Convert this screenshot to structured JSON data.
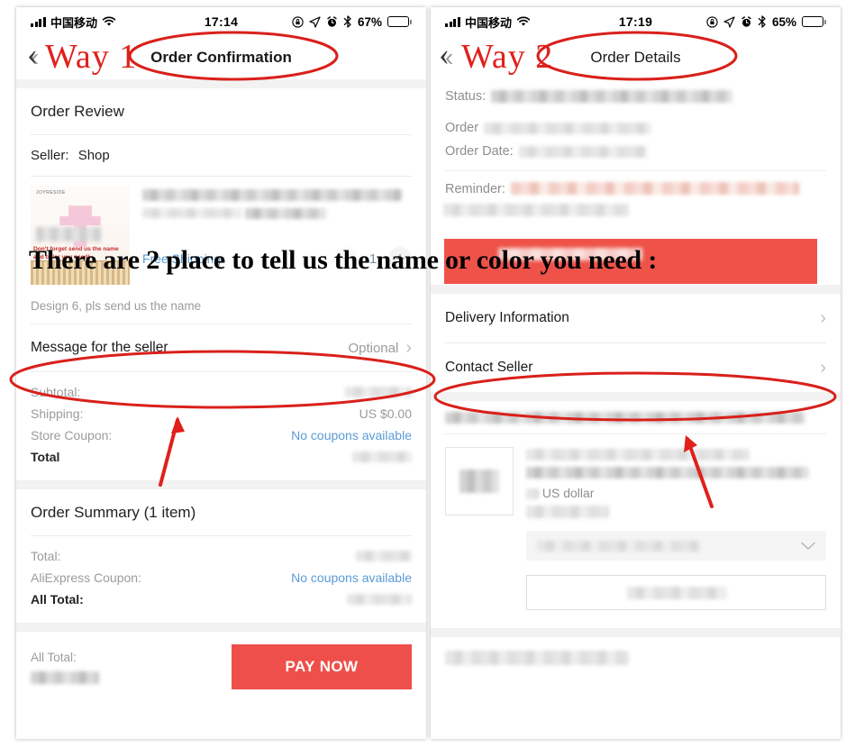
{
  "annotations": {
    "way1_label": "Way 1",
    "way2_label": "Way 2",
    "back_caret": "‹",
    "overlay_text": "There are 2 place to tell us the name or color you need :"
  },
  "left_phone": {
    "status_bar": {
      "carrier": "中国移动",
      "time": "17:14",
      "battery_percent": "67%",
      "icons": [
        "signal-bars-icon",
        "wifi-icon",
        "rotation-lock-icon",
        "location-arrow-icon",
        "alarm-clock-icon",
        "bluetooth-icon",
        "battery-icon"
      ]
    },
    "nav": {
      "back_icon": "‹",
      "title": "Order Confirmation"
    },
    "order_review": {
      "section_title": "Order Review",
      "seller_label": "Seller:",
      "seller_name": "Shop",
      "product": {
        "image_brand": "JOYRESIDE",
        "image_caption": "Don't forget send us the name and color you need!",
        "title_redacted": true,
        "free_shipping": "Free Shipping",
        "quantity": "1",
        "minus_icon": "−",
        "plus_icon": "+"
      },
      "design_note": "Design 6, pls send us the name",
      "message_for_seller": {
        "label": "Message for the seller",
        "value": "Optional",
        "chevron": "›"
      },
      "totals": [
        {
          "label": "Subtotal:",
          "value": "",
          "value_redacted": true,
          "style": "muted"
        },
        {
          "label": "Shipping:",
          "value": "US $0.00",
          "value_redacted": false,
          "style": "muted"
        },
        {
          "label": "Store Coupon:",
          "value": "No coupons available",
          "value_redacted": false,
          "style": "link"
        },
        {
          "label": "Total",
          "value": "",
          "value_redacted": true,
          "style": "bold"
        }
      ]
    },
    "order_summary": {
      "section_title": "Order Summary (1 item)",
      "rows": [
        {
          "label": "Total:",
          "value": "",
          "value_redacted": true,
          "style": "muted"
        },
        {
          "label": "AliExpress Coupon:",
          "value": "No coupons available",
          "value_redacted": false,
          "style": "link"
        },
        {
          "label": "All Total:",
          "value": "",
          "value_redacted": true,
          "style": "bold"
        }
      ]
    },
    "pay_bar": {
      "all_total_label": "All Total:",
      "all_total_value_redacted": true,
      "pay_button": "PAY NOW"
    }
  },
  "right_phone": {
    "status_bar": {
      "carrier": "中国移动",
      "time": "17:19",
      "battery_percent": "65%",
      "icons": [
        "signal-bars-icon",
        "wifi-icon",
        "rotation-lock-icon",
        "location-arrow-icon",
        "alarm-clock-icon",
        "bluetooth-icon",
        "battery-icon"
      ]
    },
    "nav": {
      "back_icon": "‹",
      "title": "Order Details"
    },
    "order_info": {
      "status_label": "Status:",
      "order_label": "Order",
      "order_date_label": "Order Date:",
      "reminder_label": "Reminder:",
      "status_redacted": true,
      "order_redacted": true,
      "order_date_redacted": true,
      "reminder_redacted": true
    },
    "links": [
      {
        "label": "Delivery Information",
        "chevron": "›"
      },
      {
        "label": "Contact Seller",
        "chevron": "›"
      }
    ],
    "product": {
      "title_redacted": true,
      "price_currency": "US dollar",
      "subtitle_redacted": true,
      "select_value_redacted": true,
      "select_chevron": "⌄",
      "button_label_redacted": true
    }
  },
  "colors": {
    "accent_red": "#EF4F4A",
    "annotation_red": "#E0201B",
    "link_blue": "#5B9BD5",
    "muted_gray": "#9B9B9B",
    "panel_gray": "#F2F2F2"
  }
}
